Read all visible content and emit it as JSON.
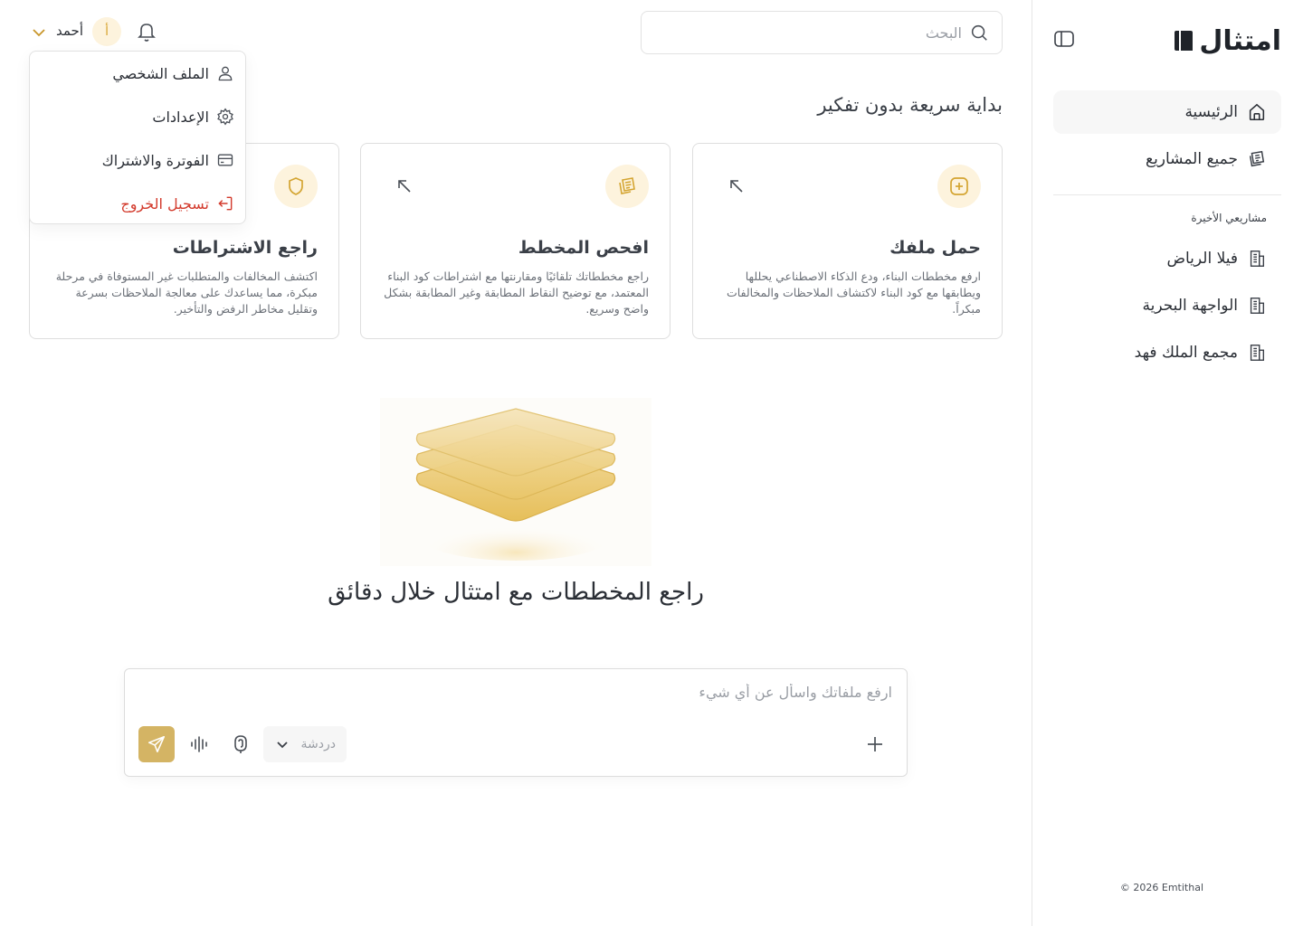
{
  "brand": {
    "name": "امتثال"
  },
  "sidebar": {
    "nav": [
      {
        "label": "الرئيسية",
        "icon": "home-icon",
        "active": true
      },
      {
        "label": "جميع المشاريع",
        "icon": "projects-icon",
        "active": false
      }
    ],
    "recent_title": "مشاريعي الأخيرة",
    "recent": [
      {
        "label": "فيلا الرياض",
        "icon": "building-icon"
      },
      {
        "label": "الواجهة البحرية",
        "icon": "building-icon"
      },
      {
        "label": "مجمع الملك فهد",
        "icon": "building-icon"
      }
    ],
    "footer": "© 2026 Emtithal"
  },
  "header": {
    "search_placeholder": "البحث",
    "user": {
      "name": "أحمد",
      "initial": "أ"
    }
  },
  "user_menu": {
    "items": [
      {
        "label": "الملف الشخصي",
        "icon": "user-icon"
      },
      {
        "label": "الإعدادات",
        "icon": "gear-icon"
      },
      {
        "label": "الفوترة والاشتراك",
        "icon": "credit-card-icon"
      },
      {
        "label": "تسجيل الخروج",
        "icon": "logout-icon",
        "danger": true
      }
    ]
  },
  "quick_start": {
    "title": "بداية سريعة بدون تفكير",
    "cards": [
      {
        "title": "حمل ملفك",
        "description": "ارفع مخططات البناء، ودع الذكاء الاصطناعي يحللها ويطابقها مع كود البناء لاكتشاف الملاحظات والمخالفات مبكراً."
      },
      {
        "title": "افحص المخطط",
        "description": "راجع مخططاتك تلقائيًا ومقارنتها مع اشتراطات كود البناء المعتمد، مع توضيح النقاط المطابقة وغير المطابقة بشكل واضح وسريع."
      },
      {
        "title": "راجع الاشتراطات",
        "description": "اكتشف المخالفات والمتطلبات غير المستوفاة في مرحلة مبكرة، مما يساعدك على معالجة الملاحظات بسرعة وتقليل مخاطر الرفض والتأخير."
      }
    ]
  },
  "hero": {
    "title": "راجع المخططات مع امتثال خلال دقائق"
  },
  "composer": {
    "placeholder": "ارفع ملفاتك واسأل عن أي شيء",
    "mode": "دردشة"
  },
  "colors": {
    "accent": "#d4b464",
    "accent_soft": "#fdf3dd",
    "danger": "#d33a2c"
  }
}
